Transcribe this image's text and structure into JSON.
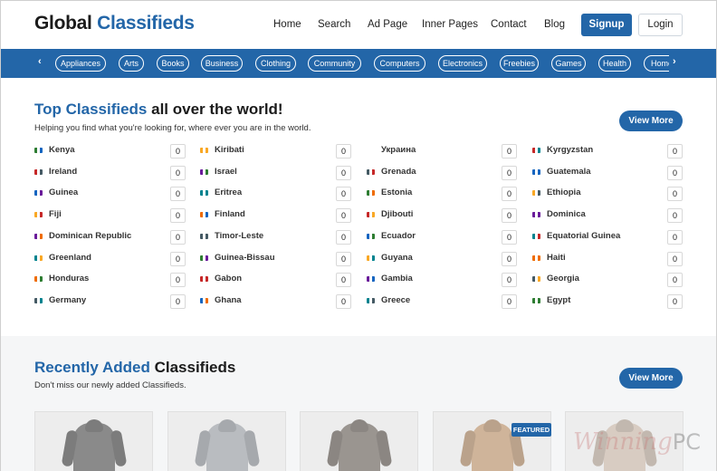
{
  "brand": {
    "part1": "Global",
    "part2": "Classifieds",
    "accent_color": "#2366a8"
  },
  "nav": {
    "items": [
      "Home",
      "Search",
      "Ad Page",
      "Inner Pages",
      "Contact",
      "Blog"
    ],
    "signup": "Signup",
    "login": "Login"
  },
  "categories": {
    "prev_icon": "chevron-left-icon",
    "next_icon": "chevron-right-icon",
    "items": [
      "Appliances",
      "Arts",
      "Books",
      "Business",
      "Clothing",
      "Community",
      "Computers",
      "Electronics",
      "Freebies",
      "Games",
      "Health",
      "Home"
    ]
  },
  "top": {
    "title_accent": "Top Classifieds",
    "title_rest": "all over the world!",
    "subtitle": "Helping you find what you're looking for, where ever you are in the world.",
    "view_more": "View More",
    "columns": [
      [
        {
          "name": "Kenya",
          "count": "0"
        },
        {
          "name": "Ireland",
          "count": "0"
        },
        {
          "name": "Guinea",
          "count": "0"
        },
        {
          "name": "Fiji",
          "count": "0"
        },
        {
          "name": "Dominican Republic",
          "count": "0"
        },
        {
          "name": "Greenland",
          "count": "0"
        },
        {
          "name": "Honduras",
          "count": "0"
        },
        {
          "name": "Germany",
          "count": "0"
        }
      ],
      [
        {
          "name": "Kiribati",
          "count": "0"
        },
        {
          "name": "Israel",
          "count": "0"
        },
        {
          "name": "Eritrea",
          "count": "0"
        },
        {
          "name": "Finland",
          "count": "0"
        },
        {
          "name": "Timor-Leste",
          "count": "0"
        },
        {
          "name": "Guinea-Bissau",
          "count": "0"
        },
        {
          "name": "Gabon",
          "count": "0"
        },
        {
          "name": "Ghana",
          "count": "0"
        }
      ],
      [
        {
          "name": "Украина",
          "count": "0"
        },
        {
          "name": "Grenada",
          "count": "0"
        },
        {
          "name": "Estonia",
          "count": "0"
        },
        {
          "name": "Djibouti",
          "count": "0"
        },
        {
          "name": "Ecuador",
          "count": "0"
        },
        {
          "name": "Guyana",
          "count": "0"
        },
        {
          "name": "Gambia",
          "count": "0"
        },
        {
          "name": "Greece",
          "count": "0"
        }
      ],
      [
        {
          "name": "Kyrgyzstan",
          "count": "0"
        },
        {
          "name": "Guatemala",
          "count": "0"
        },
        {
          "name": "Ethiopia",
          "count": "0"
        },
        {
          "name": "Dominica",
          "count": "0"
        },
        {
          "name": "Equatorial Guinea",
          "count": "0"
        },
        {
          "name": "Haiti",
          "count": "0"
        },
        {
          "name": "Georgia",
          "count": "0"
        },
        {
          "name": "Egypt",
          "count": "0"
        }
      ]
    ]
  },
  "recent": {
    "title_accent": "Recently Added",
    "title_rest": "Classifieds",
    "subtitle": "Don't miss our newly added Classifieds.",
    "view_more": "View More",
    "featured_badge": "FEATURED",
    "products": [
      {
        "color": "#8a8a8a"
      },
      {
        "color": "#b9bcc0"
      },
      {
        "color": "#9a9590"
      },
      {
        "color": "#cfb49a"
      },
      {
        "color": "#d8ccc2"
      }
    ]
  },
  "watermark": {
    "text": "Winning",
    "pc": "PC"
  }
}
